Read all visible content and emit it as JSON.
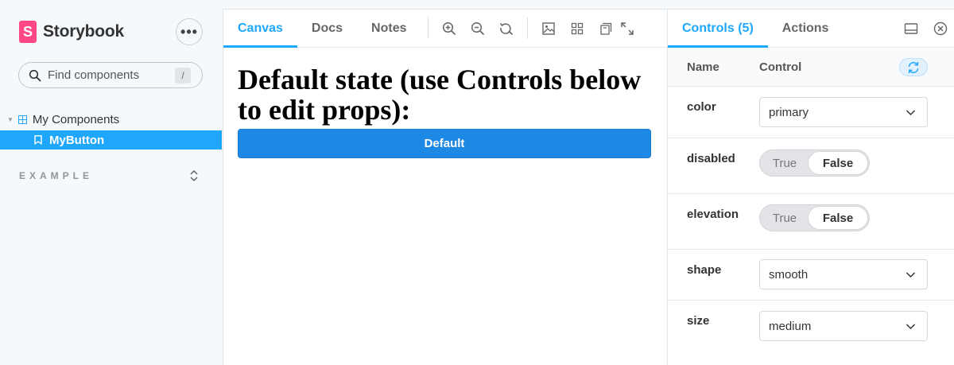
{
  "brand": {
    "logo_letter": "S",
    "name": "Storybook",
    "accent": "#ff4785"
  },
  "sidebar": {
    "menu_label": "•••",
    "search": {
      "placeholder": "Find components",
      "shortcut": "/"
    },
    "tree": {
      "group_label": "My Components",
      "selected_item": "MyButton"
    },
    "section_label": "EXAMPLE",
    "selected_color": "#1ea7fd"
  },
  "canvas": {
    "tabs": [
      {
        "label": "Canvas",
        "active": true
      },
      {
        "label": "Docs",
        "active": false
      },
      {
        "label": "Notes",
        "active": false
      }
    ],
    "toolbar_icons": [
      "zoom-in-icon",
      "zoom-out-icon",
      "zoom-reset-icon",
      "background-icon",
      "grid-icon",
      "outline-icon",
      "fullscreen-icon"
    ],
    "heading": "Default state (use Controls below to edit props):",
    "button_label": "Default",
    "button_color": "#1e88e5"
  },
  "controls": {
    "tabs": [
      {
        "label": "Controls (5)",
        "active": true
      },
      {
        "label": "Actions",
        "active": false
      }
    ],
    "header": {
      "name": "Name",
      "control": "Control"
    },
    "rows": [
      {
        "name": "color",
        "type": "select",
        "value": "primary"
      },
      {
        "name": "disabled",
        "type": "boolean",
        "true_label": "True",
        "false_label": "False",
        "value": false
      },
      {
        "name": "elevation",
        "type": "boolean",
        "true_label": "True",
        "false_label": "False",
        "value": false
      },
      {
        "name": "shape",
        "type": "select",
        "value": "smooth"
      },
      {
        "name": "size",
        "type": "select",
        "value": "medium"
      }
    ]
  }
}
